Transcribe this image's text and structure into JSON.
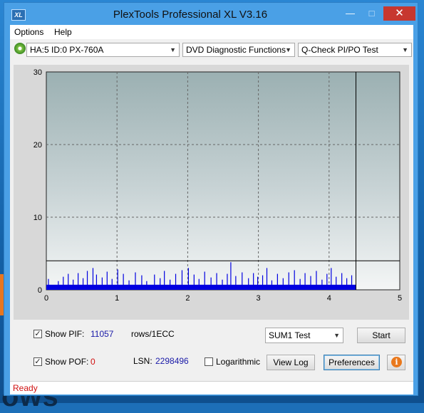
{
  "window": {
    "title": "PlexTools Professional XL V3.16",
    "icon_text": "XL",
    "buttons": {
      "minimize": "—",
      "maximize": "□",
      "close": "✕"
    }
  },
  "menu": {
    "options": "Options",
    "help": "Help"
  },
  "toolbar": {
    "drive": "HA:5 ID:0  PX-760A",
    "function": "DVD Diagnostic Functions",
    "test": "Q-Check PI/PO Test"
  },
  "chart_data": {
    "type": "bar",
    "xlim": [
      0,
      5
    ],
    "ylim": [
      0,
      30
    ],
    "x_ticks": [
      "0",
      "1",
      "2",
      "3",
      "4",
      "5"
    ],
    "y_ticks": [
      "0",
      "10",
      "20",
      "30"
    ],
    "grid": true,
    "threshold_line": 4,
    "scan_end": 4.38,
    "series_color": "#0000e0",
    "pif_spikes": [
      {
        "x": 0.03,
        "y": 1.5
      },
      {
        "x": 0.17,
        "y": 1.2
      },
      {
        "x": 0.24,
        "y": 1.8
      },
      {
        "x": 0.31,
        "y": 2.2
      },
      {
        "x": 0.38,
        "y": 1.4
      },
      {
        "x": 0.45,
        "y": 2.3
      },
      {
        "x": 0.52,
        "y": 1.6
      },
      {
        "x": 0.58,
        "y": 2.6
      },
      {
        "x": 0.66,
        "y": 3.0
      },
      {
        "x": 0.71,
        "y": 2.1
      },
      {
        "x": 0.79,
        "y": 1.7
      },
      {
        "x": 0.86,
        "y": 2.5
      },
      {
        "x": 0.93,
        "y": 1.5
      },
      {
        "x": 1.01,
        "y": 2.8
      },
      {
        "x": 1.09,
        "y": 2.2
      },
      {
        "x": 1.17,
        "y": 1.3
      },
      {
        "x": 1.26,
        "y": 2.4
      },
      {
        "x": 1.35,
        "y": 2.0
      },
      {
        "x": 1.42,
        "y": 1.2
      },
      {
        "x": 1.53,
        "y": 2.1
      },
      {
        "x": 1.61,
        "y": 1.6
      },
      {
        "x": 1.67,
        "y": 2.6
      },
      {
        "x": 1.75,
        "y": 1.4
      },
      {
        "x": 1.83,
        "y": 2.2
      },
      {
        "x": 1.92,
        "y": 2.7
      },
      {
        "x": 2.01,
        "y": 3.0
      },
      {
        "x": 2.09,
        "y": 2.1
      },
      {
        "x": 2.16,
        "y": 1.5
      },
      {
        "x": 2.24,
        "y": 2.5
      },
      {
        "x": 2.33,
        "y": 1.7
      },
      {
        "x": 2.41,
        "y": 2.3
      },
      {
        "x": 2.49,
        "y": 1.4
      },
      {
        "x": 2.56,
        "y": 2.2
      },
      {
        "x": 2.61,
        "y": 3.8
      },
      {
        "x": 2.68,
        "y": 1.9
      },
      {
        "x": 2.77,
        "y": 2.4
      },
      {
        "x": 2.86,
        "y": 1.6
      },
      {
        "x": 2.93,
        "y": 2.3
      },
      {
        "x": 2.99,
        "y": 1.8
      },
      {
        "x": 3.06,
        "y": 2.0
      },
      {
        "x": 3.12,
        "y": 3.0
      },
      {
        "x": 3.19,
        "y": 1.3
      },
      {
        "x": 3.27,
        "y": 2.2
      },
      {
        "x": 3.35,
        "y": 1.6
      },
      {
        "x": 3.43,
        "y": 2.4
      },
      {
        "x": 3.51,
        "y": 2.7
      },
      {
        "x": 3.59,
        "y": 1.5
      },
      {
        "x": 3.66,
        "y": 2.3
      },
      {
        "x": 3.74,
        "y": 1.9
      },
      {
        "x": 3.82,
        "y": 2.6
      },
      {
        "x": 3.9,
        "y": 1.4
      },
      {
        "x": 3.97,
        "y": 2.2
      },
      {
        "x": 4.03,
        "y": 3.0
      },
      {
        "x": 4.1,
        "y": 1.8
      },
      {
        "x": 4.18,
        "y": 2.3
      },
      {
        "x": 4.25,
        "y": 1.6
      },
      {
        "x": 4.32,
        "y": 2.0
      }
    ]
  },
  "controls": {
    "show_pif_label": "Show PIF:",
    "show_pif_checked": "✓",
    "pif_value": "11057",
    "unit": "rows/1ECC",
    "show_pof_label": "Show POF:",
    "show_pof_checked": "✓",
    "pof_value": "0",
    "lsn_label": "LSN:",
    "lsn_value": "2298496",
    "logarithmic_label": "Logarithmic",
    "sum_select": "SUM1 Test",
    "start_button": "Start",
    "view_log_button": "View Log",
    "preferences_button": "Preferences",
    "info_icon": "i"
  },
  "status": {
    "text": "Ready"
  }
}
